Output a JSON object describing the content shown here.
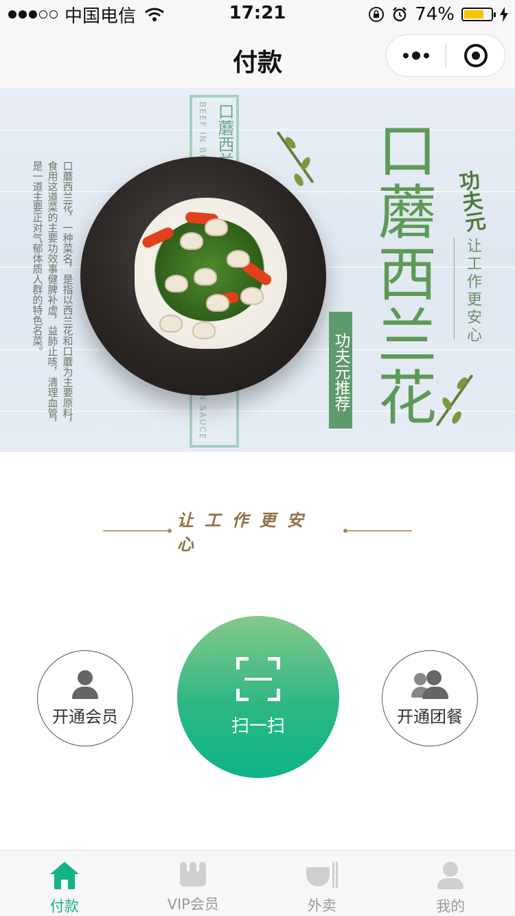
{
  "status_bar": {
    "carrier": "中国电信",
    "time": "17:21",
    "battery_percent": "74%",
    "battery_level": 0.74
  },
  "nav": {
    "title": "付款"
  },
  "banner": {
    "big_title": "口蘑西兰花",
    "frame_title": "口蘑西兰花",
    "frame_en_top": "BEEF IN BROWN",
    "frame_en_bottom": "IN SAUCE",
    "description": [
      "口蘑西兰花，一种菜名，是指以西兰花和口蘑为主要原料，",
      "食用这道菜的主要功效事健脾补虚，益肺止咳，清理血管，",
      "是一道主要正对气郁体质人群的特色名菜。"
    ],
    "tag": "功夫元推荐",
    "brand": "功夫元",
    "slogan": "让工作更安心"
  },
  "divider": {
    "text": "让工作更安心"
  },
  "actions": {
    "member": "开通会员",
    "scan": "扫一扫",
    "group": "开通团餐"
  },
  "tab_bar": {
    "tabs": [
      {
        "label": "付款",
        "icon": "home-icon",
        "active": true
      },
      {
        "label": "VIP会员",
        "icon": "crown-icon",
        "active": false
      },
      {
        "label": "外卖",
        "icon": "bowl-icon",
        "active": false
      },
      {
        "label": "我的",
        "icon": "person-icon",
        "active": false
      }
    ]
  },
  "colors": {
    "accent": "#13b287",
    "banner_green": "#5e9a57",
    "gold": "#8f7045"
  }
}
